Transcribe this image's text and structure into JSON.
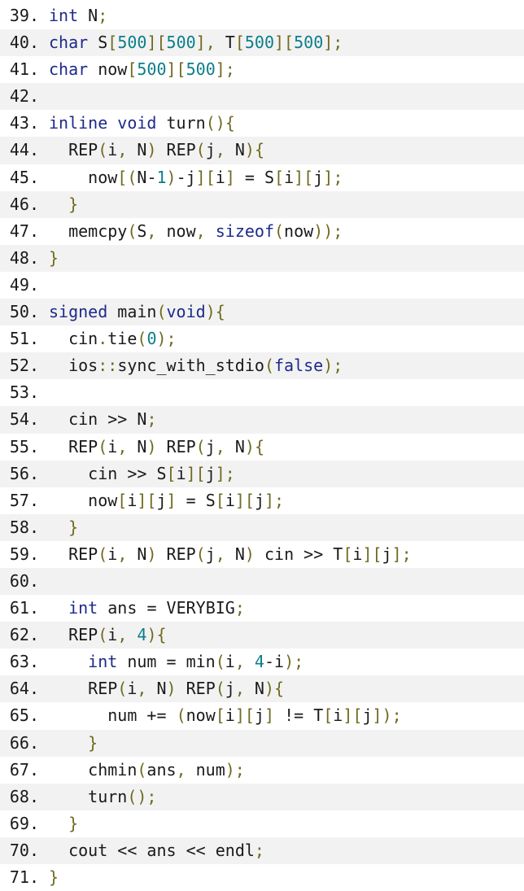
{
  "colors": {
    "background": "#ffffff",
    "stripe": "#f2f2f2",
    "keyword": "#1d2a8a",
    "number": "#0b7e8a",
    "punctuation": "#6f6a1f",
    "text": "#1a1a1a"
  },
  "lines": [
    {
      "n": "39.",
      "t": [
        {
          "k": "kw",
          "v": "int"
        },
        {
          "k": "tx",
          "v": " N"
        },
        {
          "k": "pn",
          "v": ";"
        }
      ]
    },
    {
      "n": "40.",
      "t": [
        {
          "k": "kw",
          "v": "char"
        },
        {
          "k": "tx",
          "v": " S"
        },
        {
          "k": "pn",
          "v": "["
        },
        {
          "k": "num",
          "v": "500"
        },
        {
          "k": "pn",
          "v": "]["
        },
        {
          "k": "num",
          "v": "500"
        },
        {
          "k": "pn",
          "v": "],"
        },
        {
          "k": "tx",
          "v": " T"
        },
        {
          "k": "pn",
          "v": "["
        },
        {
          "k": "num",
          "v": "500"
        },
        {
          "k": "pn",
          "v": "]["
        },
        {
          "k": "num",
          "v": "500"
        },
        {
          "k": "pn",
          "v": "];"
        }
      ]
    },
    {
      "n": "41.",
      "t": [
        {
          "k": "kw",
          "v": "char"
        },
        {
          "k": "tx",
          "v": " now"
        },
        {
          "k": "pn",
          "v": "["
        },
        {
          "k": "num",
          "v": "500"
        },
        {
          "k": "pn",
          "v": "]["
        },
        {
          "k": "num",
          "v": "500"
        },
        {
          "k": "pn",
          "v": "];"
        }
      ]
    },
    {
      "n": "42.",
      "t": []
    },
    {
      "n": "43.",
      "t": [
        {
          "k": "kw",
          "v": "inline"
        },
        {
          "k": "tx",
          "v": " "
        },
        {
          "k": "kw",
          "v": "void"
        },
        {
          "k": "tx",
          "v": " turn"
        },
        {
          "k": "pn",
          "v": "(){"
        }
      ]
    },
    {
      "n": "44.",
      "t": [
        {
          "k": "tx",
          "v": "  REP"
        },
        {
          "k": "pn",
          "v": "("
        },
        {
          "k": "tx",
          "v": "i"
        },
        {
          "k": "pn",
          "v": ","
        },
        {
          "k": "tx",
          "v": " N"
        },
        {
          "k": "pn",
          "v": ")"
        },
        {
          "k": "tx",
          "v": " REP"
        },
        {
          "k": "pn",
          "v": "("
        },
        {
          "k": "tx",
          "v": "j"
        },
        {
          "k": "pn",
          "v": ","
        },
        {
          "k": "tx",
          "v": " N"
        },
        {
          "k": "pn",
          "v": "){"
        }
      ]
    },
    {
      "n": "45.",
      "t": [
        {
          "k": "tx",
          "v": "    now"
        },
        {
          "k": "pn",
          "v": "[("
        },
        {
          "k": "tx",
          "v": "N"
        },
        {
          "k": "op",
          "v": "-"
        },
        {
          "k": "num",
          "v": "1"
        },
        {
          "k": "pn",
          "v": ")"
        },
        {
          "k": "op",
          "v": "-"
        },
        {
          "k": "tx",
          "v": "j"
        },
        {
          "k": "pn",
          "v": "]["
        },
        {
          "k": "tx",
          "v": "i"
        },
        {
          "k": "pn",
          "v": "]"
        },
        {
          "k": "tx",
          "v": " "
        },
        {
          "k": "op",
          "v": "="
        },
        {
          "k": "tx",
          "v": " S"
        },
        {
          "k": "pn",
          "v": "["
        },
        {
          "k": "tx",
          "v": "i"
        },
        {
          "k": "pn",
          "v": "]["
        },
        {
          "k": "tx",
          "v": "j"
        },
        {
          "k": "pn",
          "v": "];"
        }
      ]
    },
    {
      "n": "46.",
      "t": [
        {
          "k": "tx",
          "v": "  "
        },
        {
          "k": "pn",
          "v": "}"
        }
      ]
    },
    {
      "n": "47.",
      "t": [
        {
          "k": "tx",
          "v": "  memcpy"
        },
        {
          "k": "pn",
          "v": "("
        },
        {
          "k": "tx",
          "v": "S"
        },
        {
          "k": "pn",
          "v": ","
        },
        {
          "k": "tx",
          "v": " now"
        },
        {
          "k": "pn",
          "v": ","
        },
        {
          "k": "tx",
          "v": " "
        },
        {
          "k": "kw",
          "v": "sizeof"
        },
        {
          "k": "pn",
          "v": "("
        },
        {
          "k": "tx",
          "v": "now"
        },
        {
          "k": "pn",
          "v": "));"
        }
      ]
    },
    {
      "n": "48.",
      "t": [
        {
          "k": "pn",
          "v": "}"
        }
      ]
    },
    {
      "n": "49.",
      "t": []
    },
    {
      "n": "50.",
      "t": [
        {
          "k": "kw",
          "v": "signed"
        },
        {
          "k": "tx",
          "v": " main"
        },
        {
          "k": "pn",
          "v": "("
        },
        {
          "k": "kw",
          "v": "void"
        },
        {
          "k": "pn",
          "v": "){"
        }
      ]
    },
    {
      "n": "51.",
      "t": [
        {
          "k": "tx",
          "v": "  cin"
        },
        {
          "k": "pn",
          "v": "."
        },
        {
          "k": "tx",
          "v": "tie"
        },
        {
          "k": "pn",
          "v": "("
        },
        {
          "k": "num",
          "v": "0"
        },
        {
          "k": "pn",
          "v": ");"
        }
      ]
    },
    {
      "n": "52.",
      "t": [
        {
          "k": "tx",
          "v": "  ios"
        },
        {
          "k": "pn",
          "v": "::"
        },
        {
          "k": "tx",
          "v": "sync_with_stdio"
        },
        {
          "k": "pn",
          "v": "("
        },
        {
          "k": "kw",
          "v": "false"
        },
        {
          "k": "pn",
          "v": ");"
        }
      ]
    },
    {
      "n": "53.",
      "t": []
    },
    {
      "n": "54.",
      "t": [
        {
          "k": "tx",
          "v": "  cin "
        },
        {
          "k": "op",
          "v": ">>"
        },
        {
          "k": "tx",
          "v": " N"
        },
        {
          "k": "pn",
          "v": ";"
        }
      ]
    },
    {
      "n": "55.",
      "t": [
        {
          "k": "tx",
          "v": "  REP"
        },
        {
          "k": "pn",
          "v": "("
        },
        {
          "k": "tx",
          "v": "i"
        },
        {
          "k": "pn",
          "v": ","
        },
        {
          "k": "tx",
          "v": " N"
        },
        {
          "k": "pn",
          "v": ")"
        },
        {
          "k": "tx",
          "v": " REP"
        },
        {
          "k": "pn",
          "v": "("
        },
        {
          "k": "tx",
          "v": "j"
        },
        {
          "k": "pn",
          "v": ","
        },
        {
          "k": "tx",
          "v": " N"
        },
        {
          "k": "pn",
          "v": "){"
        }
      ]
    },
    {
      "n": "56.",
      "t": [
        {
          "k": "tx",
          "v": "    cin "
        },
        {
          "k": "op",
          "v": ">>"
        },
        {
          "k": "tx",
          "v": " S"
        },
        {
          "k": "pn",
          "v": "["
        },
        {
          "k": "tx",
          "v": "i"
        },
        {
          "k": "pn",
          "v": "]["
        },
        {
          "k": "tx",
          "v": "j"
        },
        {
          "k": "pn",
          "v": "];"
        }
      ]
    },
    {
      "n": "57.",
      "t": [
        {
          "k": "tx",
          "v": "    now"
        },
        {
          "k": "pn",
          "v": "["
        },
        {
          "k": "tx",
          "v": "i"
        },
        {
          "k": "pn",
          "v": "]["
        },
        {
          "k": "tx",
          "v": "j"
        },
        {
          "k": "pn",
          "v": "]"
        },
        {
          "k": "tx",
          "v": " "
        },
        {
          "k": "op",
          "v": "="
        },
        {
          "k": "tx",
          "v": " S"
        },
        {
          "k": "pn",
          "v": "["
        },
        {
          "k": "tx",
          "v": "i"
        },
        {
          "k": "pn",
          "v": "]["
        },
        {
          "k": "tx",
          "v": "j"
        },
        {
          "k": "pn",
          "v": "];"
        }
      ]
    },
    {
      "n": "58.",
      "t": [
        {
          "k": "tx",
          "v": "  "
        },
        {
          "k": "pn",
          "v": "}"
        }
      ]
    },
    {
      "n": "59.",
      "t": [
        {
          "k": "tx",
          "v": "  REP"
        },
        {
          "k": "pn",
          "v": "("
        },
        {
          "k": "tx",
          "v": "i"
        },
        {
          "k": "pn",
          "v": ","
        },
        {
          "k": "tx",
          "v": " N"
        },
        {
          "k": "pn",
          "v": ")"
        },
        {
          "k": "tx",
          "v": " REP"
        },
        {
          "k": "pn",
          "v": "("
        },
        {
          "k": "tx",
          "v": "j"
        },
        {
          "k": "pn",
          "v": ","
        },
        {
          "k": "tx",
          "v": " N"
        },
        {
          "k": "pn",
          "v": ")"
        },
        {
          "k": "tx",
          "v": " cin "
        },
        {
          "k": "op",
          "v": ">>"
        },
        {
          "k": "tx",
          "v": " T"
        },
        {
          "k": "pn",
          "v": "["
        },
        {
          "k": "tx",
          "v": "i"
        },
        {
          "k": "pn",
          "v": "]["
        },
        {
          "k": "tx",
          "v": "j"
        },
        {
          "k": "pn",
          "v": "];"
        }
      ]
    },
    {
      "n": "60.",
      "t": []
    },
    {
      "n": "61.",
      "t": [
        {
          "k": "tx",
          "v": "  "
        },
        {
          "k": "kw",
          "v": "int"
        },
        {
          "k": "tx",
          "v": " ans "
        },
        {
          "k": "op",
          "v": "="
        },
        {
          "k": "tx",
          "v": " VERYBIG"
        },
        {
          "k": "pn",
          "v": ";"
        }
      ]
    },
    {
      "n": "62.",
      "t": [
        {
          "k": "tx",
          "v": "  REP"
        },
        {
          "k": "pn",
          "v": "("
        },
        {
          "k": "tx",
          "v": "i"
        },
        {
          "k": "pn",
          "v": ","
        },
        {
          "k": "tx",
          "v": " "
        },
        {
          "k": "num",
          "v": "4"
        },
        {
          "k": "pn",
          "v": "){"
        }
      ]
    },
    {
      "n": "63.",
      "t": [
        {
          "k": "tx",
          "v": "    "
        },
        {
          "k": "kw",
          "v": "int"
        },
        {
          "k": "tx",
          "v": " num "
        },
        {
          "k": "op",
          "v": "="
        },
        {
          "k": "tx",
          "v": " min"
        },
        {
          "k": "pn",
          "v": "("
        },
        {
          "k": "tx",
          "v": "i"
        },
        {
          "k": "pn",
          "v": ","
        },
        {
          "k": "tx",
          "v": " "
        },
        {
          "k": "num",
          "v": "4"
        },
        {
          "k": "op",
          "v": "-"
        },
        {
          "k": "tx",
          "v": "i"
        },
        {
          "k": "pn",
          "v": ");"
        }
      ]
    },
    {
      "n": "64.",
      "t": [
        {
          "k": "tx",
          "v": "    REP"
        },
        {
          "k": "pn",
          "v": "("
        },
        {
          "k": "tx",
          "v": "i"
        },
        {
          "k": "pn",
          "v": ","
        },
        {
          "k": "tx",
          "v": " N"
        },
        {
          "k": "pn",
          "v": ")"
        },
        {
          "k": "tx",
          "v": " REP"
        },
        {
          "k": "pn",
          "v": "("
        },
        {
          "k": "tx",
          "v": "j"
        },
        {
          "k": "pn",
          "v": ","
        },
        {
          "k": "tx",
          "v": " N"
        },
        {
          "k": "pn",
          "v": "){"
        }
      ]
    },
    {
      "n": "65.",
      "t": [
        {
          "k": "tx",
          "v": "      num "
        },
        {
          "k": "op",
          "v": "+="
        },
        {
          "k": "tx",
          "v": " "
        },
        {
          "k": "pn",
          "v": "("
        },
        {
          "k": "tx",
          "v": "now"
        },
        {
          "k": "pn",
          "v": "["
        },
        {
          "k": "tx",
          "v": "i"
        },
        {
          "k": "pn",
          "v": "]["
        },
        {
          "k": "tx",
          "v": "j"
        },
        {
          "k": "pn",
          "v": "]"
        },
        {
          "k": "tx",
          "v": " "
        },
        {
          "k": "op",
          "v": "!="
        },
        {
          "k": "tx",
          "v": " T"
        },
        {
          "k": "pn",
          "v": "["
        },
        {
          "k": "tx",
          "v": "i"
        },
        {
          "k": "pn",
          "v": "]["
        },
        {
          "k": "tx",
          "v": "j"
        },
        {
          "k": "pn",
          "v": "]);"
        }
      ]
    },
    {
      "n": "66.",
      "t": [
        {
          "k": "tx",
          "v": "    "
        },
        {
          "k": "pn",
          "v": "}"
        }
      ]
    },
    {
      "n": "67.",
      "t": [
        {
          "k": "tx",
          "v": "    chmin"
        },
        {
          "k": "pn",
          "v": "("
        },
        {
          "k": "tx",
          "v": "ans"
        },
        {
          "k": "pn",
          "v": ","
        },
        {
          "k": "tx",
          "v": " num"
        },
        {
          "k": "pn",
          "v": ");"
        }
      ]
    },
    {
      "n": "68.",
      "t": [
        {
          "k": "tx",
          "v": "    turn"
        },
        {
          "k": "pn",
          "v": "();"
        }
      ]
    },
    {
      "n": "69.",
      "t": [
        {
          "k": "tx",
          "v": "  "
        },
        {
          "k": "pn",
          "v": "}"
        }
      ]
    },
    {
      "n": "70.",
      "t": [
        {
          "k": "tx",
          "v": "  cout "
        },
        {
          "k": "op",
          "v": "<<"
        },
        {
          "k": "tx",
          "v": " ans "
        },
        {
          "k": "op",
          "v": "<<"
        },
        {
          "k": "tx",
          "v": " endl"
        },
        {
          "k": "pn",
          "v": ";"
        }
      ]
    },
    {
      "n": "71.",
      "t": [
        {
          "k": "pn",
          "v": "}"
        }
      ]
    }
  ]
}
